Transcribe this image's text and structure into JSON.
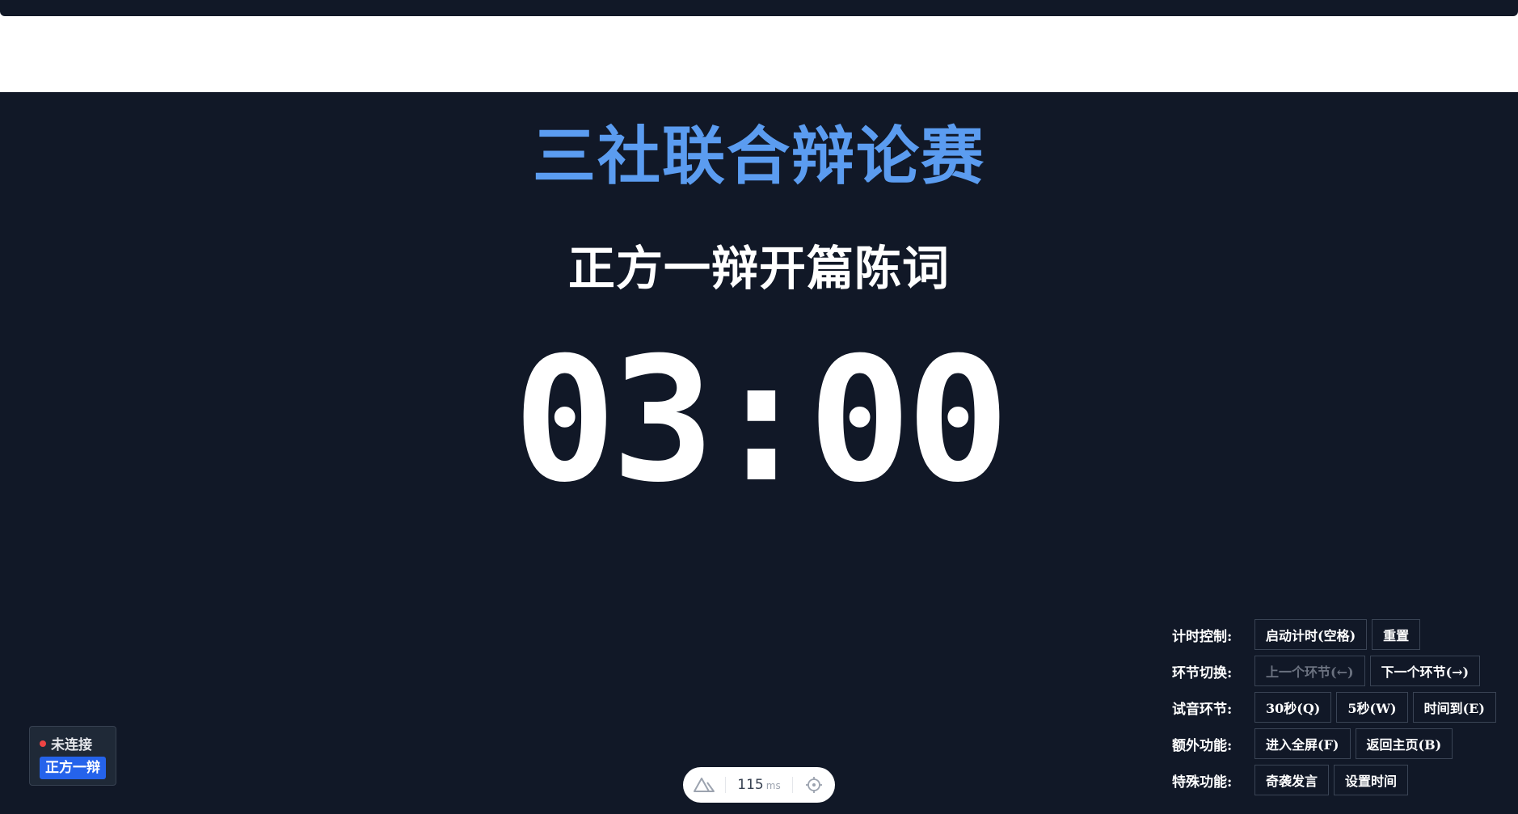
{
  "event_title": "三社联合辩论赛",
  "segment_title": "正方一辩开篇陈词",
  "timer": "03:00",
  "controls": {
    "timing": {
      "label": "计时控制:",
      "start": "启动计时(空格)",
      "reset": "重置"
    },
    "segment": {
      "label": "环节切换:",
      "prev": "上一个环节(←)",
      "next": "下一个环节(→)"
    },
    "sound": {
      "label": "试音环节:",
      "s30": "30秒(Q)",
      "s5": "5秒(W)",
      "timeup": "时间到(E)"
    },
    "extra": {
      "label": "额外功能:",
      "fullscreen": "进入全屏(F)",
      "home": "返回主页(B)"
    },
    "special": {
      "label": "特殊功能:",
      "surprise": "奇袭发言",
      "set_time": "设置时间"
    }
  },
  "status": {
    "connection": "未连接",
    "speaker": "正方一辩",
    "connection_color": "#ef4444"
  },
  "devtools": {
    "ping_value": "115",
    "ping_unit": "ms",
    "logo_icon": "nuxt-logo-icon",
    "inspect_icon": "crosshair-icon"
  },
  "colors": {
    "background": "#111827",
    "accent": "#5b9cf0",
    "speaker_badge": "#2563eb"
  }
}
